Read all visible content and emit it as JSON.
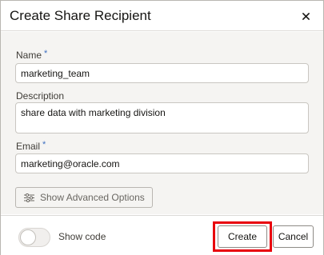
{
  "dialog": {
    "title": "Create Share Recipient",
    "close_icon": "close-icon"
  },
  "form": {
    "name_label": "Name",
    "name_required_mark": "*",
    "name_value": "marketing_team",
    "description_label": "Description",
    "description_value": "share data with marketing division",
    "email_label": "Email",
    "email_required_mark": "*",
    "email_value": "marketing@oracle.com",
    "advanced_button_label": "Show Advanced Options",
    "advanced_icon": "sliders-icon"
  },
  "footer": {
    "show_code_label": "Show code",
    "show_code_on": false,
    "create_label": "Create",
    "cancel_label": "Cancel"
  },
  "colors": {
    "required_mark": "#3d6fc1",
    "highlight_box": "#e8000b",
    "body_background": "#f5f4f2"
  }
}
